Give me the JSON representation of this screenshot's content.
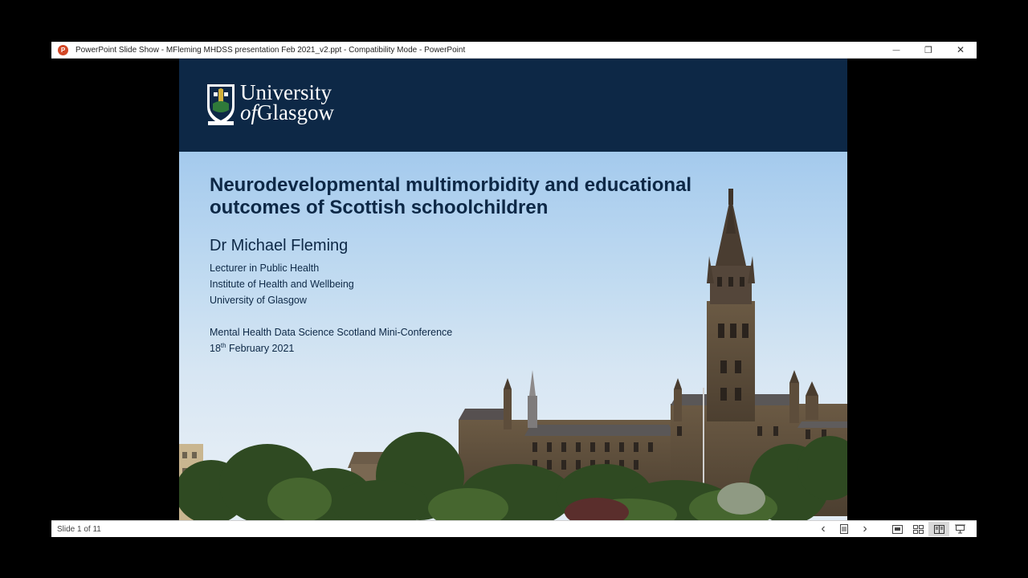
{
  "window": {
    "title": "PowerPoint Slide Show  -  MFleming MHDSS presentation Feb 2021_v2.ppt  -  Compatibility Mode - PowerPoint",
    "app_icon_letter": "P",
    "minimize_glyph": "—",
    "restore_glyph": "❐",
    "close_glyph": "✕"
  },
  "slide": {
    "logo_line1": "University",
    "logo_of": "of",
    "logo_line2": "Glasgow",
    "title": "Neurodevelopmental multimorbidity and educational outcomes of Scottish schoolchildren",
    "presenter": "Dr Michael Fleming",
    "role": "Lecturer in Public Health",
    "institute": "Institute of Health and Wellbeing",
    "university": "University of Glasgow",
    "event": "Mental Health Data Science Scotland Mini-Conference",
    "date_day": "18",
    "date_suffix": "th",
    "date_rest": " February 2021"
  },
  "statusbar": {
    "slide_counter": "Slide 1 of 11",
    "prev_glyph": "‹",
    "next_glyph": "›"
  },
  "icons": {
    "app": "powerpoint-icon",
    "minimize": "minimize-icon",
    "restore": "restore-icon",
    "close": "close-icon",
    "prev": "chevron-left-icon",
    "notes": "slide-menu-icon",
    "next": "chevron-right-icon",
    "normal_view": "normal-view-icon",
    "sorter_view": "slide-sorter-icon",
    "reading_view": "reading-view-icon",
    "slideshow_view": "slideshow-icon"
  },
  "colors": {
    "header_navy": "#0d2846",
    "title_text": "#0d2846",
    "ppt_orange": "#d24726"
  }
}
